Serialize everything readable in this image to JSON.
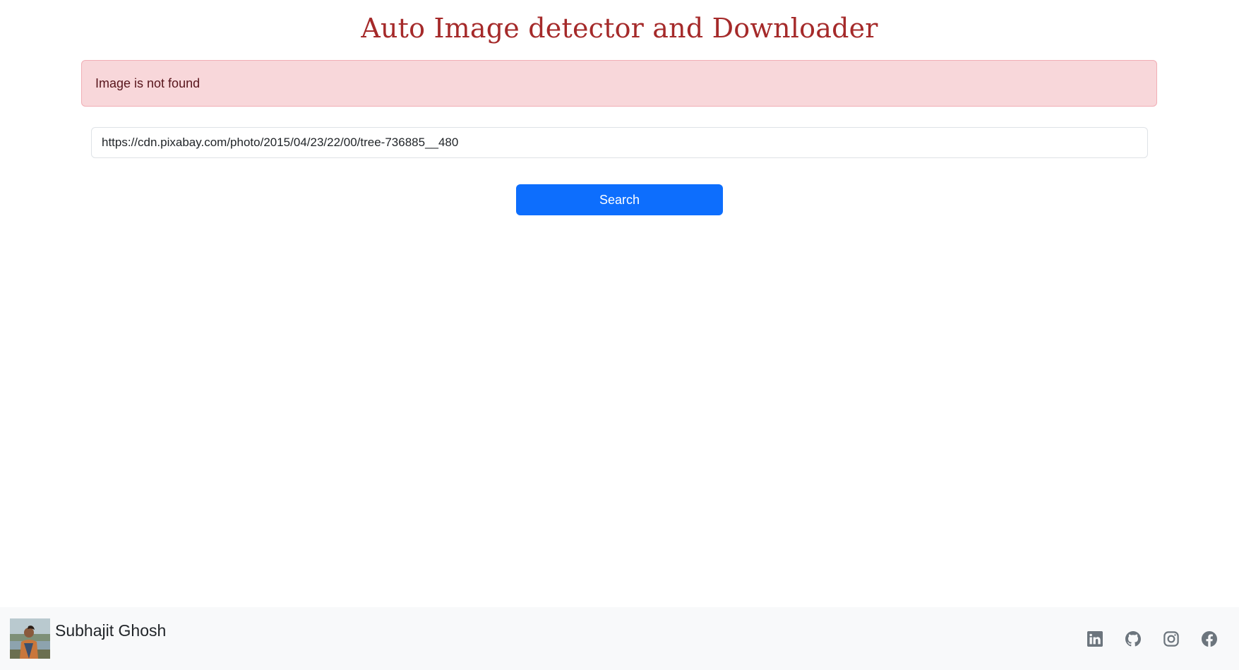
{
  "page": {
    "title": "Auto Image detector and Downloader"
  },
  "alert": {
    "message": "Image is not found"
  },
  "search": {
    "url_value": "https://cdn.pixabay.com/photo/2015/04/23/22/00/tree-736885__480",
    "button_label": "Search"
  },
  "footer": {
    "author_name": "Subhajit Ghosh",
    "social_icons": [
      "linkedin-icon",
      "github-icon",
      "instagram-icon",
      "facebook-icon"
    ]
  },
  "colors": {
    "title": "#a52a2a",
    "alert_bg": "#f8d7da",
    "alert_text": "#58151c",
    "primary_button": "#0d6efd",
    "footer_bg": "#f8f9fa",
    "icon": "#6c757d"
  }
}
